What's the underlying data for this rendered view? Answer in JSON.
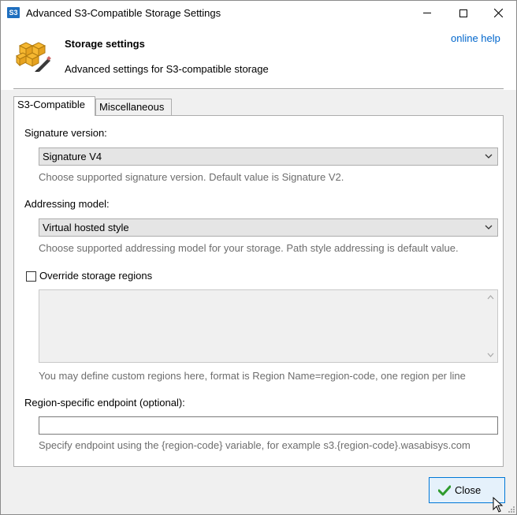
{
  "window": {
    "app_icon_text": "S3",
    "title": "Advanced S3-Compatible Storage Settings"
  },
  "header": {
    "title": "Storage settings",
    "subtitle": "Advanced settings for S3-compatible storage",
    "help_link": "online help",
    "icon": "storage-boxes-pencil-icon"
  },
  "tabs": [
    {
      "label": "S3-Compatible",
      "active": true
    },
    {
      "label": "Miscellaneous",
      "active": false
    }
  ],
  "signature": {
    "label": "Signature version:",
    "value": "Signature V4",
    "hint": "Choose supported signature version. Default value is Signature V2."
  },
  "addressing": {
    "label": "Addressing model:",
    "value": "Virtual hosted style",
    "hint": "Choose supported addressing model for your storage. Path style addressing is default value."
  },
  "regions": {
    "checkbox_label": "Override storage regions",
    "checked": false,
    "value": "",
    "hint": "You may define custom regions here, format is Region Name=region-code, one region per line"
  },
  "endpoint": {
    "label": "Region-specific endpoint (optional):",
    "value": "",
    "hint": "Specify endpoint using the {region-code} variable, for example s3.{region-code}.wasabisys.com"
  },
  "footer": {
    "close_label": "Close"
  },
  "colors": {
    "link": "#0066cc",
    "hint_text": "#6d6d6d",
    "button_border": "#0078d7",
    "button_bg": "#e5f1fb",
    "icon_box": "#f5b731"
  }
}
